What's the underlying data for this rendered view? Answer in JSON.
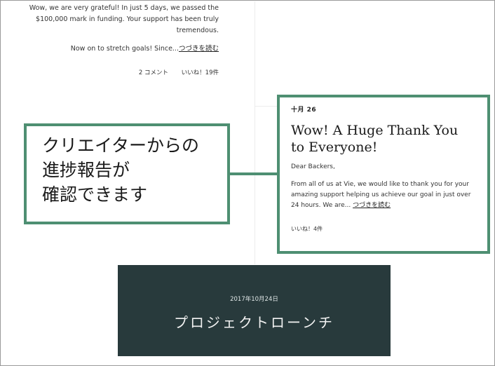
{
  "update_left": {
    "lines": [
      "Wow, we are very grateful! In just 5 days, we passed the",
      "$100,000 mark in funding. Your support has been truly",
      "tremendous."
    ],
    "more_text": "Now on to stretch goals! Since...",
    "more_link": "つづきを読む",
    "comments": "2 コメント",
    "likes": "いいね！19件"
  },
  "update_right": {
    "date": "十月 26",
    "title": "Wow! A Huge Thank You to Everyone!",
    "greeting": "Dear Backers,",
    "body": "From all of us at Vie, we would like to thank you for your amazing support helping us achieve our goal in just over 24 hours. We are...",
    "more_link": "つづきを読む",
    "likes": "いいね！4件"
  },
  "callout": {
    "line1": "クリエイターからの",
    "line2": "進捗報告が",
    "line3": "確認できます"
  },
  "launch": {
    "date": "2017年10月24日",
    "title": "プロジェクトローンチ"
  },
  "colors": {
    "accent": "#4e8f72",
    "banner": "#283a3c"
  }
}
